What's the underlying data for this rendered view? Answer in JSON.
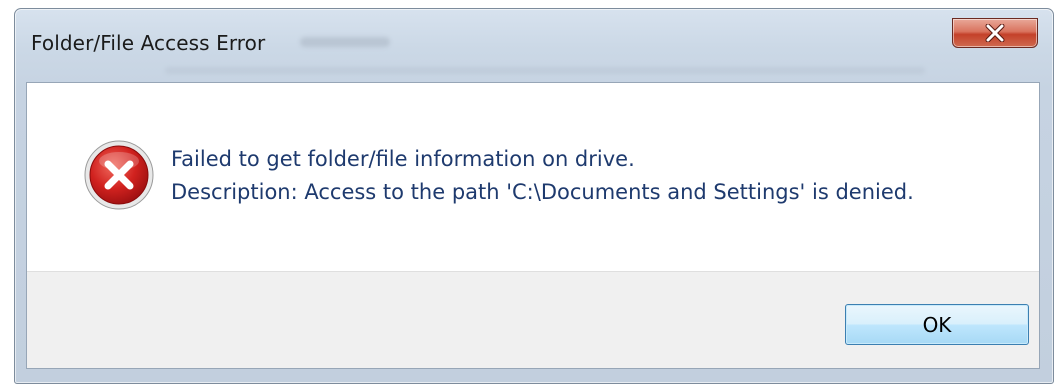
{
  "window": {
    "title": "Folder/File Access Error"
  },
  "message": {
    "icon": "error-icon",
    "line1": "Failed to get folder/file information on drive.",
    "line2": "Description: Access to the path 'C:\\Documents and Settings' is denied."
  },
  "buttons": {
    "ok_label": "OK",
    "close_icon": "close-icon"
  },
  "colors": {
    "message_text": "#1e3a6e",
    "error_red": "#c8191b",
    "close_button": "#c4412a",
    "ok_border": "#3c7fb1"
  }
}
